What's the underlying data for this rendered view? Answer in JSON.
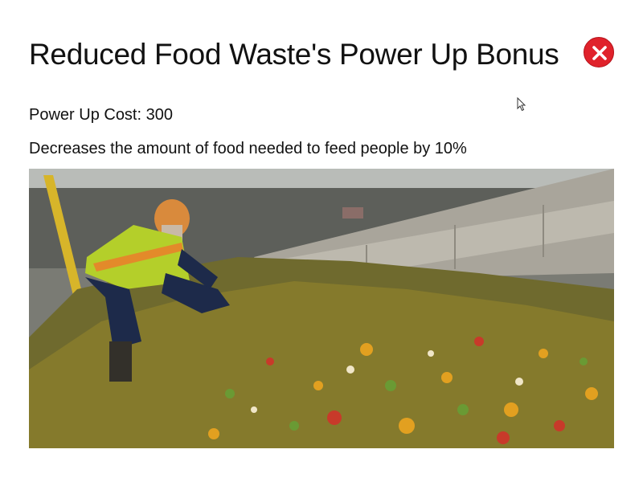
{
  "dialog": {
    "title": "Reduced Food Waste's Power Up Bonus",
    "cost_text": "Power Up Cost: 300",
    "description": "Decreases the amount of food needed to feed people by 10%",
    "close_icon": "close-icon",
    "close_color": "#e0222b"
  },
  "image": {
    "subject": "worker in hi-vis vest sorting a large heap of discarded fruit and vegetables"
  }
}
